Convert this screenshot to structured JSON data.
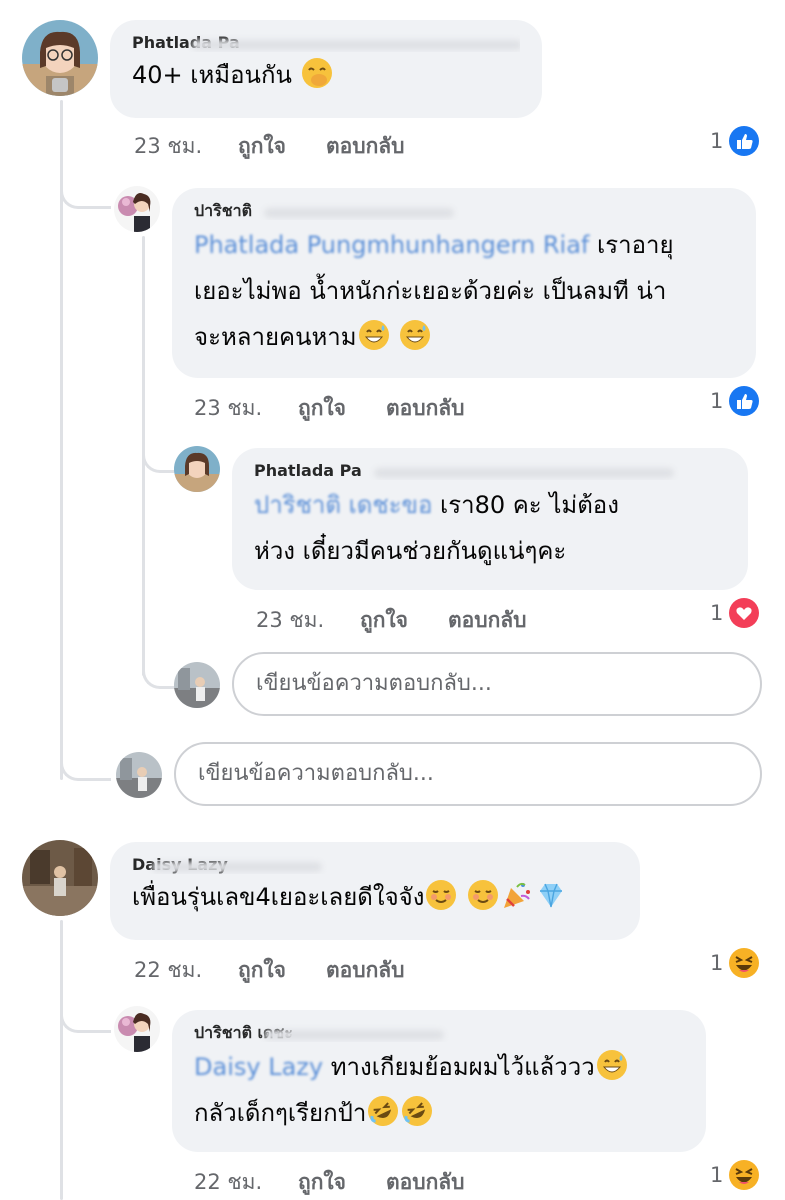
{
  "comments": [
    {
      "id": "c1",
      "author": "Phatlada Pa",
      "text": "40+ เหมือนกัน",
      "time": "23 ชม.",
      "like_label": "ถูกใจ",
      "reply_label": "ตอบกลับ",
      "reaction_count": "1",
      "reaction": "like-icon"
    },
    {
      "id": "r1",
      "author": "ปาริชาติ",
      "mention": "Phatlada Pungmhunhangern Riaf",
      "text_line1": "เราอายุ",
      "text_line2": "เยอะไม่พอ  น้ำหนักก่ะเยอะด้วยค่ะ  เป็นลมที น่า",
      "text_line3": "จะหลายคนหาม",
      "time": "23 ชม.",
      "like_label": "ถูกใจ",
      "reply_label": "ตอบกลับ",
      "reaction_count": "1",
      "reaction": "like-icon"
    },
    {
      "id": "r2",
      "author": "Phatlada Pa",
      "mention": "ปาริชาติ เดชะขอ",
      "text_line1": "เรา80 คะ ไม่ต้อง",
      "text_line2": "ห่วง เดี๋ยวมีคนช่วยกันดูแน่ๆคะ",
      "time": "23 ชม.",
      "like_label": "ถูกใจ",
      "reply_label": "ตอบกลับ",
      "reaction_count": "1",
      "reaction": "love-icon"
    },
    {
      "id": "c2",
      "author": "Daisy Lazy",
      "text": "เพื่อนรุ่นเลข4เยอะเลยดีใจจัง",
      "time": "22 ชม.",
      "like_label": "ถูกใจ",
      "reply_label": "ตอบกลับ",
      "reaction_count": "1",
      "reaction": "haha-icon"
    },
    {
      "id": "r3",
      "author": "ปาริชาติ เดชะ",
      "mention": "Daisy Lazy",
      "text_line1": "ทางเกียมย้อมผมไว้แล้ววว",
      "text_line2": "กลัวเด็กๆเรียกป้า",
      "time": "22 ชม.",
      "like_label": "ถูกใจ",
      "reply_label": "ตอบกลับ",
      "reaction_count": "1",
      "reaction": "haha-icon"
    }
  ],
  "reply_inputs": {
    "nested_placeholder": "เขียนข้อความตอบกลับ...",
    "thread_placeholder": "เขียนข้อความตอบกลับ..."
  },
  "colors": {
    "bubble": "#f0f2f5",
    "meta": "#65676b",
    "like_blue": "#1877f2",
    "love_red": "#f33e58",
    "haha_yellow": "#f7b125"
  }
}
